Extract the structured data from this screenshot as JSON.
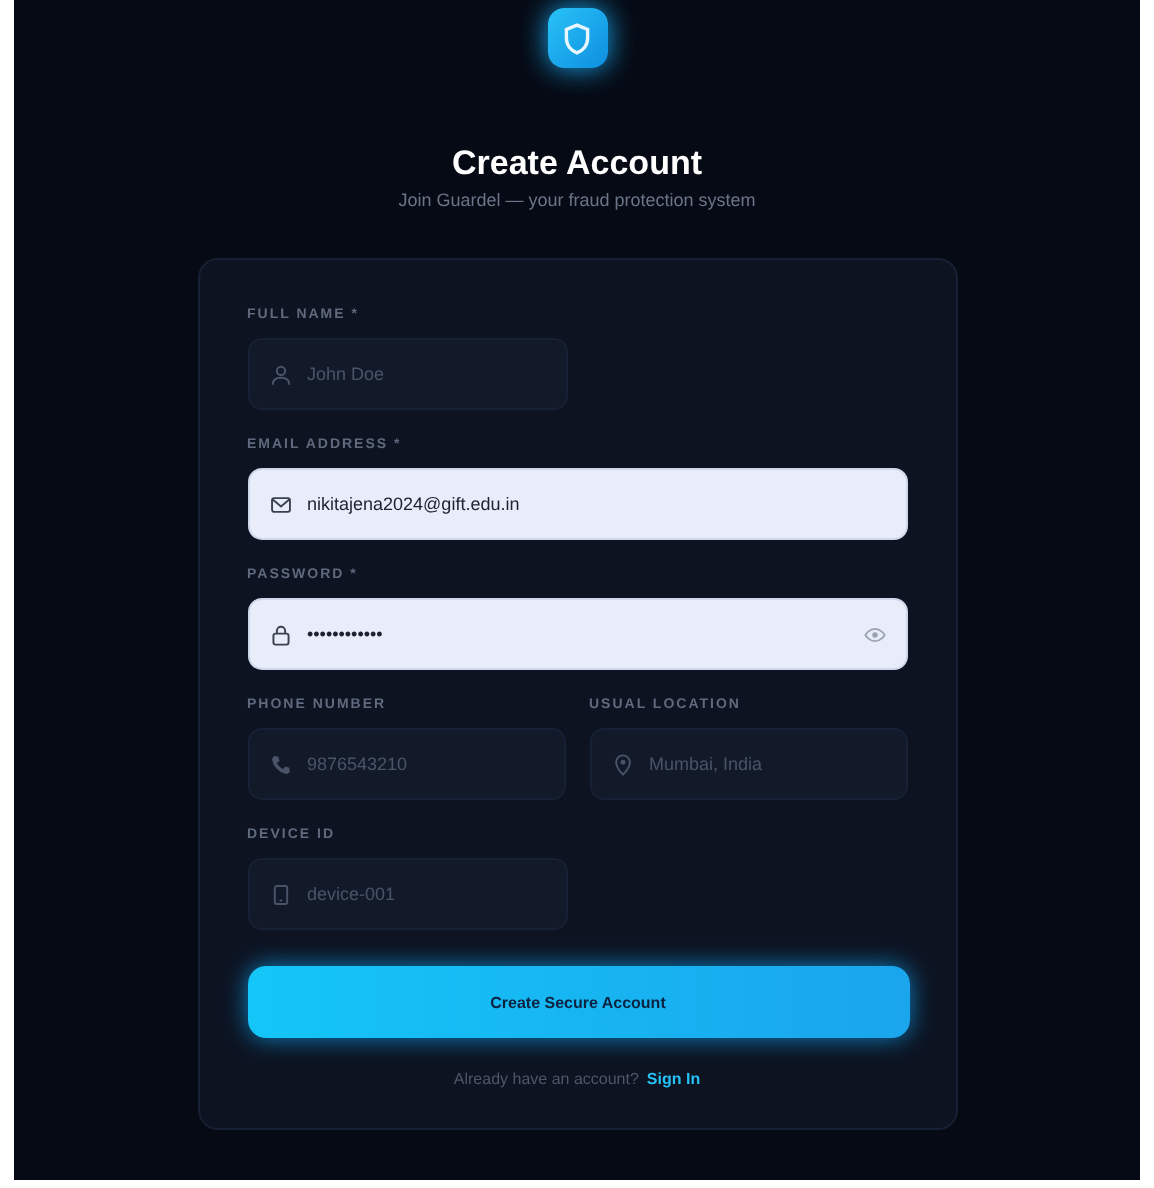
{
  "header": {
    "title": "Create Account",
    "subtitle": "Join Guardel — your fraud protection system"
  },
  "form": {
    "rows": [
      [
        {
          "kind": "name",
          "label": "FULL NAME",
          "required_mark": "*",
          "placeholder": "John Doe"
        }
      ],
      [
        {
          "kind": "email",
          "label": "EMAIL ADDRESS",
          "required_mark": "*",
          "value": "nikitajena2024@gift.edu.in"
        }
      ],
      [
        {
          "kind": "password",
          "label": "PASSWORD",
          "required_mark": "*",
          "value": "••••••••••••"
        }
      ],
      [
        {
          "kind": "phone",
          "label": "PHONE NUMBER",
          "placeholder": "9876543210"
        },
        {
          "kind": "location",
          "label": "USUAL LOCATION",
          "placeholder": "Mumbai, India"
        }
      ],
      [
        {
          "kind": "device",
          "label": "DEVICE ID",
          "placeholder": "device-001"
        }
      ]
    ],
    "submit": "Create Secure Account",
    "footer": {
      "text": "Already have an account?",
      "link": "Sign In"
    }
  }
}
